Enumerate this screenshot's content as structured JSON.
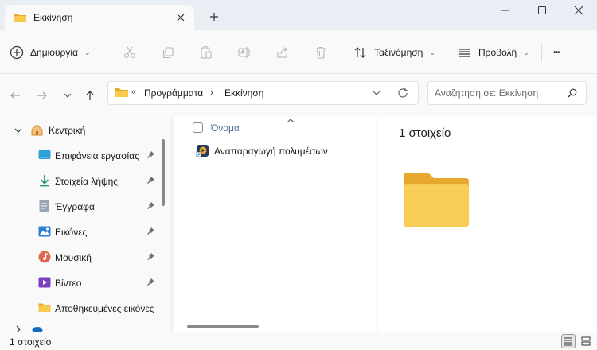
{
  "tab": {
    "title": "Εκκίνηση"
  },
  "toolbar": {
    "new_label": "Δημιουργία",
    "sort_label": "Ταξινόμηση",
    "view_label": "Προβολή",
    "more_label": "•••"
  },
  "address": {
    "overflow": "«",
    "segments": [
      "Προγράμματα",
      "Εκκίνηση"
    ],
    "separator": "›"
  },
  "search": {
    "placeholder": "Αναζήτηση σε: Εκκίνηση"
  },
  "sidebar": {
    "items": [
      {
        "label": "Κεντρική",
        "icon": "home-icon"
      },
      {
        "label": "Επιφάνεια εργασίας",
        "icon": "desktop-icon",
        "pinned": true
      },
      {
        "label": "Στοιχεία λήψης",
        "icon": "download-icon",
        "pinned": true
      },
      {
        "label": "Έγγραφα",
        "icon": "documents-icon",
        "pinned": true
      },
      {
        "label": "Εικόνες",
        "icon": "pictures-icon",
        "pinned": true
      },
      {
        "label": "Μουσική",
        "icon": "music-icon",
        "pinned": true
      },
      {
        "label": "Βίντεο",
        "icon": "video-icon",
        "pinned": true
      },
      {
        "label": "Αποθηκευμένες εικόνες",
        "icon": "folder-icon"
      }
    ]
  },
  "list": {
    "column_name": "Όνομα",
    "files": [
      {
        "name": "Αναπαραγωγή πολυμέσων",
        "icon": "media-player-shortcut-icon"
      }
    ]
  },
  "preview": {
    "count_label": "1 στοιχείο"
  },
  "status": {
    "item_count": "1 στοιχείο"
  },
  "colors": {
    "accent": "#0067c0",
    "folder": "#f8c94a",
    "title_bg": "#e9eef5"
  }
}
